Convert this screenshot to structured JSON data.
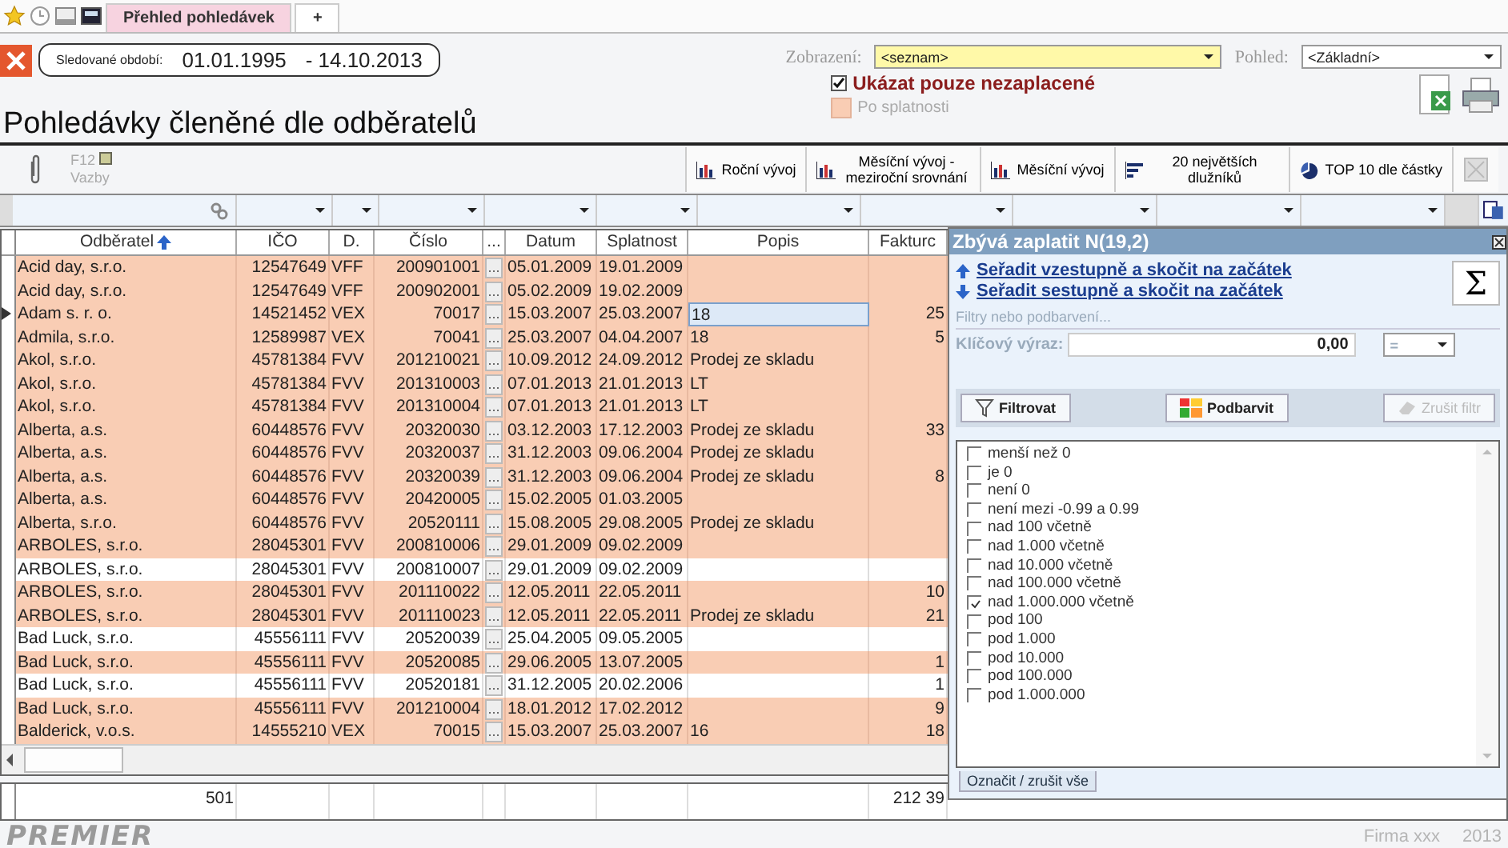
{
  "tabs": [
    {
      "label": "Přehled pohledávek",
      "selected": true
    },
    {
      "label": "+",
      "selected": false
    }
  ],
  "period": {
    "label": "Sledované období:",
    "from": "01.01.1995",
    "to": "- 14.10.2013"
  },
  "view": {
    "label": "Zobrazení:",
    "value": "<seznam>"
  },
  "perspective": {
    "label": "Pohled:",
    "value": "<Základní>"
  },
  "options": [
    {
      "label": "Ukázat pouze nezaplacené",
      "checked": true,
      "disabled": false
    },
    {
      "label": "Po splatnosti",
      "checked": false,
      "disabled": true
    }
  ],
  "title": "Pohledávky členěné dle odběratelů",
  "links": {
    "key": "F12",
    "label": "Vazby"
  },
  "actions": [
    {
      "label": "Roční vývoj",
      "kind": "bars"
    },
    {
      "label": "Měsíční vývoj - meziroční srovnání",
      "kind": "bars"
    },
    {
      "label": "Měsíční vývoj",
      "kind": "bars"
    },
    {
      "label": "20 největších dlužníků",
      "kind": "hbars"
    },
    {
      "label": "TOP 10 dle částky",
      "kind": "pie"
    }
  ],
  "table": {
    "columns": [
      {
        "label": "Odběratel",
        "sorted": true
      },
      {
        "label": "IČO",
        "sorted": false
      },
      {
        "label": "D.",
        "sorted": false
      },
      {
        "label": "Číslo",
        "sorted": false
      },
      {
        "label": "...",
        "sorted": false
      },
      {
        "label": "Datum",
        "sorted": false
      },
      {
        "label": "Splatnost",
        "sorted": false
      },
      {
        "label": "Popis",
        "sorted": false
      },
      {
        "label": "Fakturc",
        "sorted": false
      }
    ],
    "rows": [
      {
        "cells": [
          "Acid day, s.r.o.",
          "12547649",
          "VFF",
          "200901001",
          "...",
          "05.01.2009",
          "19.01.2009",
          "",
          ""
        ],
        "overdue": true,
        "selected": false
      },
      {
        "cells": [
          "Acid day, s.r.o.",
          "12547649",
          "VFF",
          "200902001",
          "...",
          "05.02.2009",
          "19.02.2009",
          "",
          ""
        ],
        "overdue": true,
        "selected": false
      },
      {
        "cells": [
          "Adam s. r. o.",
          "14521452",
          "VEX",
          "70017",
          "...",
          "15.03.2007",
          "25.03.2007",
          "18",
          "25"
        ],
        "overdue": true,
        "selected": true
      },
      {
        "cells": [
          "Admila, s.r.o.",
          "12589987",
          "VEX",
          "70041",
          "...",
          "25.03.2007",
          "04.04.2007",
          "18",
          "5"
        ],
        "overdue": true,
        "selected": false
      },
      {
        "cells": [
          "Akol, s.r.o.",
          "45781384",
          "FVV",
          "201210021",
          "...",
          "10.09.2012",
          "24.09.2012",
          "Prodej ze skladu",
          ""
        ],
        "overdue": true,
        "selected": false
      },
      {
        "cells": [
          "Akol, s.r.o.",
          "45781384",
          "FVV",
          "201310003",
          "...",
          "07.01.2013",
          "21.01.2013",
          "LT",
          ""
        ],
        "overdue": true,
        "selected": false
      },
      {
        "cells": [
          "Akol, s.r.o.",
          "45781384",
          "FVV",
          "201310004",
          "...",
          "07.01.2013",
          "21.01.2013",
          "LT",
          ""
        ],
        "overdue": true,
        "selected": false
      },
      {
        "cells": [
          "Alberta, a.s.",
          "60448576",
          "FVV",
          "20320030",
          "...",
          "03.12.2003",
          "17.12.2003",
          "Prodej ze skladu",
          "33"
        ],
        "overdue": true,
        "selected": false
      },
      {
        "cells": [
          "Alberta, a.s.",
          "60448576",
          "FVV",
          "20320037",
          "...",
          "31.12.2003",
          "09.06.2004",
          "Prodej ze skladu",
          ""
        ],
        "overdue": true,
        "selected": false
      },
      {
        "cells": [
          "Alberta, a.s.",
          "60448576",
          "FVV",
          "20320039",
          "...",
          "31.12.2003",
          "09.06.2004",
          "Prodej ze skladu",
          "8"
        ],
        "overdue": true,
        "selected": false
      },
      {
        "cells": [
          "Alberta, a.s.",
          "60448576",
          "FVV",
          "20420005",
          "...",
          "15.02.2005",
          "01.03.2005",
          "",
          ""
        ],
        "overdue": true,
        "selected": false
      },
      {
        "cells": [
          "Alberta, s.r.o.",
          "60448576",
          "FVV",
          "20520111",
          "...",
          "15.08.2005",
          "29.08.2005",
          "Prodej ze skladu",
          ""
        ],
        "overdue": true,
        "selected": false
      },
      {
        "cells": [
          "ARBOLES, s.r.o.",
          "28045301",
          "FVV",
          "200810006",
          "...",
          "29.01.2009",
          "09.02.2009",
          "",
          ""
        ],
        "overdue": true,
        "selected": false
      },
      {
        "cells": [
          "ARBOLES, s.r.o.",
          "28045301",
          "FVV",
          "200810007",
          "...",
          "29.01.2009",
          "09.02.2009",
          "",
          ""
        ],
        "overdue": false,
        "selected": false
      },
      {
        "cells": [
          "ARBOLES, s.r.o.",
          "28045301",
          "FVV",
          "201110022",
          "...",
          "12.05.2011",
          "22.05.2011",
          "",
          "10"
        ],
        "overdue": true,
        "selected": false
      },
      {
        "cells": [
          "ARBOLES, s.r.o.",
          "28045301",
          "FVV",
          "201110023",
          "...",
          "12.05.2011",
          "22.05.2011",
          "Prodej ze skladu",
          "21"
        ],
        "overdue": true,
        "selected": false
      },
      {
        "cells": [
          "Bad Luck, s.r.o.",
          "45556111",
          "FVV",
          "20520039",
          "...",
          "25.04.2005",
          "09.05.2005",
          "",
          ""
        ],
        "overdue": false,
        "selected": false
      },
      {
        "cells": [
          "Bad Luck, s.r.o.",
          "45556111",
          "FVV",
          "20520085",
          "...",
          "29.06.2005",
          "13.07.2005",
          "",
          "1"
        ],
        "overdue": true,
        "selected": false
      },
      {
        "cells": [
          "Bad Luck, s.r.o.",
          "45556111",
          "FVV",
          "20520181",
          "...",
          "31.12.2005",
          "20.02.2006",
          "",
          "1"
        ],
        "overdue": false,
        "selected": false
      },
      {
        "cells": [
          "Bad Luck, s.r.o.",
          "45556111",
          "FVV",
          "201210004",
          "...",
          "18.01.2012",
          "17.02.2012",
          "",
          "9"
        ],
        "overdue": true,
        "selected": false
      },
      {
        "cells": [
          "Balderick, v.o.s.",
          "14555210",
          "VEX",
          "70015",
          "...",
          "15.03.2007",
          "25.03.2007",
          "16",
          "18"
        ],
        "overdue": true,
        "selected": false
      }
    ],
    "totals": [
      "501",
      "212 39"
    ]
  },
  "panel": {
    "title": "Zbývá zaplatit N(19,2)",
    "sort_links": [
      {
        "label": "Seřadit vzestupně a skočit na začátek",
        "kind": "up"
      },
      {
        "label": "Seřadit sestupně a skočit na začátek",
        "kind": "down"
      }
    ],
    "sum_button": "Σ",
    "filter_hint": "Filtry nebo podbarvení...",
    "key_label": "Klíčový výraz:",
    "key_value": "0,00",
    "operator": "=",
    "buttons": [
      {
        "label": "Filtrovat",
        "kind": "filter",
        "disabled": false
      },
      {
        "label": "Podbarvit",
        "kind": "color",
        "disabled": false
      },
      {
        "label": "Zrušit filtr",
        "kind": "erase",
        "disabled": true
      }
    ],
    "conditions": [
      {
        "label": "menší než 0",
        "checked": false
      },
      {
        "label": "je 0",
        "checked": false
      },
      {
        "label": "není 0",
        "checked": false
      },
      {
        "label": "není mezi -0.99 a 0.99",
        "checked": false
      },
      {
        "label": "nad 100 včetně",
        "checked": false
      },
      {
        "label": "nad 1.000 včetně",
        "checked": false
      },
      {
        "label": "nad 10.000 včetně",
        "checked": false
      },
      {
        "label": "nad 100.000 včetně",
        "checked": false
      },
      {
        "label": "nad 1.000.000 včetně",
        "checked": true
      },
      {
        "label": "pod 100",
        "checked": false
      },
      {
        "label": "pod 1.000",
        "checked": false
      },
      {
        "label": "pod 10.000",
        "checked": false
      },
      {
        "label": "pod 100.000",
        "checked": false
      },
      {
        "label": "pod 1.000.000",
        "checked": false
      }
    ],
    "footer_tab": "Označit / zrušit vše"
  },
  "brand": "PREMIER",
  "status": [
    "Firma xxx",
    "2013"
  ]
}
